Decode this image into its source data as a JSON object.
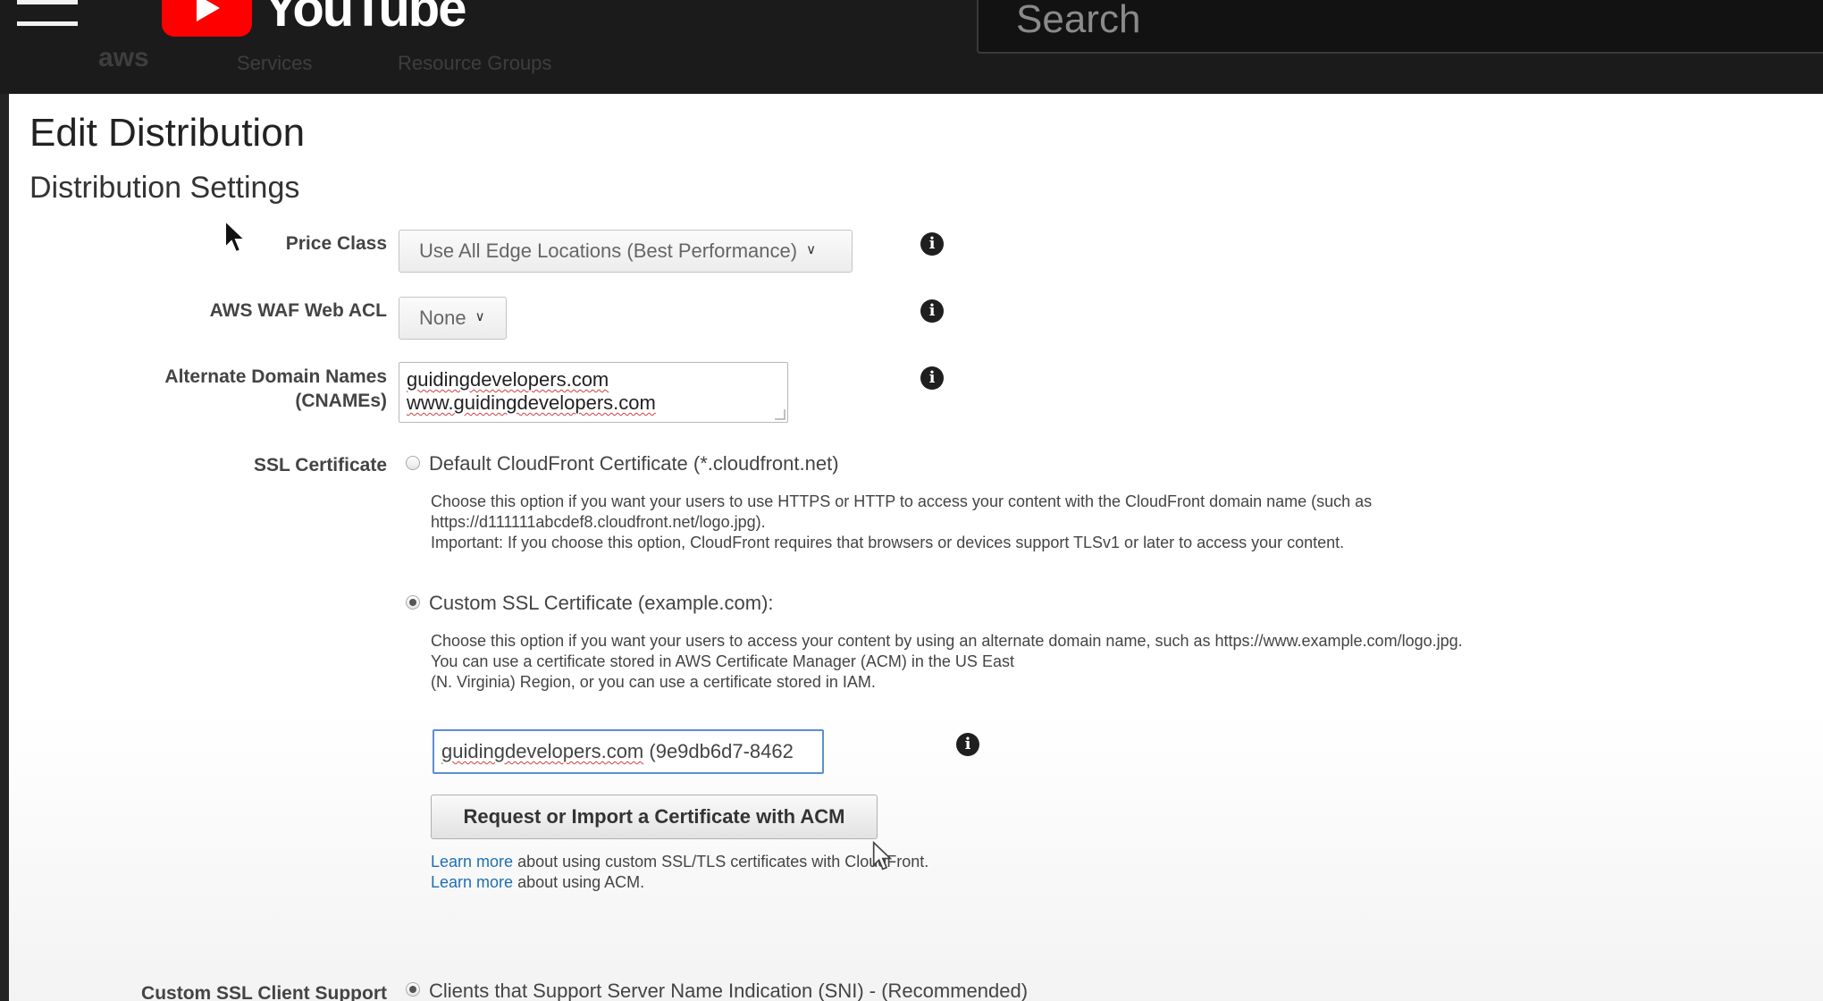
{
  "youtube": {
    "wordmark": "YouTube",
    "search_placeholder": "Search"
  },
  "aws_nav": {
    "brand": "aws",
    "services": "Services",
    "resource_groups": "Resource Groups"
  },
  "page": {
    "title": "Edit Distribution",
    "section_title": "Distribution Settings"
  },
  "fields": {
    "price_class": {
      "label": "Price Class",
      "value": "Use All Edge Locations (Best Performance)"
    },
    "waf": {
      "label": "AWS WAF Web ACL",
      "value": "None"
    },
    "cnames": {
      "label_line1": "Alternate Domain Names",
      "label_line2": "(CNAMEs)",
      "line1": "guidingdevelopers.com",
      "line2": "www.guidingdevelopers.com"
    },
    "ssl": {
      "label": "SSL Certificate",
      "default_option": "Default CloudFront Certificate (*.cloudfront.net)",
      "default_help_1": "Choose this option if you want your users to use HTTPS or HTTP to access your content with the CloudFront domain name (such as",
      "default_help_2": "https://d111111abcdef8.cloudfront.net/logo.jpg).",
      "default_help_3": "Important: If you choose this option, CloudFront requires that browsers or devices support TLSv1 or later to access your content.",
      "custom_option": "Custom SSL Certificate (example.com):",
      "custom_help_1": "Choose this option if you want your users to access your content by using an alternate domain name, such as https://www.example.com/logo.jpg.",
      "custom_help_2": "You can use a certificate stored in AWS Certificate Manager (ACM) in the US East",
      "custom_help_3": "(N. Virginia) Region, or you can use a certificate stored in IAM.",
      "cert_domain": "guidingdevelopers.com",
      "cert_id": " (9e9db6d7-8462",
      "acm_button": "Request or Import a Certificate with ACM",
      "learn_more_1": "Learn more",
      "learn_text_1": " about using custom SSL/TLS certificates with CloudFront.",
      "learn_more_2": "Learn more",
      "learn_text_2": " about using ACM.",
      "selected": "custom"
    },
    "client_support": {
      "label": "Custom SSL Client Support",
      "option": "Clients that Support Server Name Indication (SNI) - (Recommended)"
    }
  },
  "icons": {
    "info": "info-icon",
    "info_glyph": "i"
  }
}
